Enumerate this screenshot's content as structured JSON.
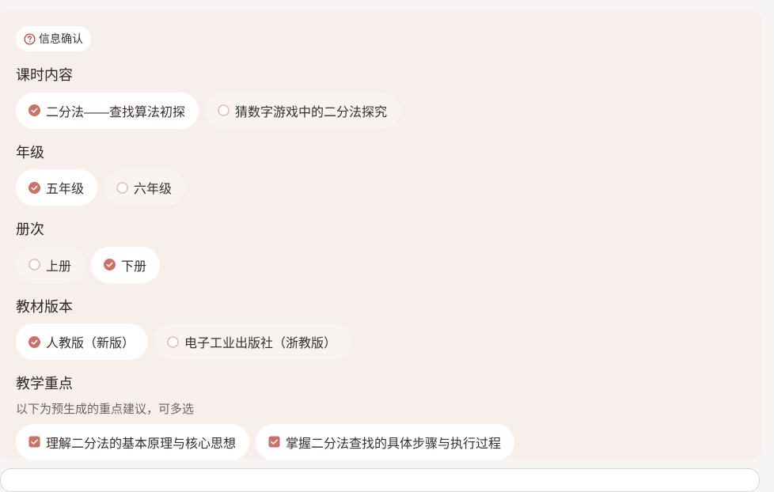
{
  "header": {
    "badge_label": "信息确认"
  },
  "sections": {
    "lesson": {
      "title": "课时内容",
      "options": [
        "二分法——查找算法初探",
        "猜数字游戏中的二分法探究"
      ],
      "selected_index": 0
    },
    "grade": {
      "title": "年级",
      "options": [
        "五年级",
        "六年级"
      ],
      "selected_index": 0
    },
    "volume": {
      "title": "册次",
      "options": [
        "上册",
        "下册"
      ],
      "selected_index": 1
    },
    "edition": {
      "title": "教材版本",
      "options": [
        "人教版（新版）",
        "电子工业出版社（浙教版）"
      ],
      "selected_index": 0
    },
    "focus": {
      "title": "教学重点",
      "hint": "以下为预生成的重点建议，可多选",
      "options": [
        "理解二分法的基本原理与核心思想",
        "掌握二分法查找的具体步骤与执行过程"
      ],
      "checked": [
        true,
        true
      ]
    }
  },
  "colors": {
    "accent": "#c9726a",
    "panel_bg": "#f7efec",
    "radio_ring": "#e8b4ae"
  }
}
